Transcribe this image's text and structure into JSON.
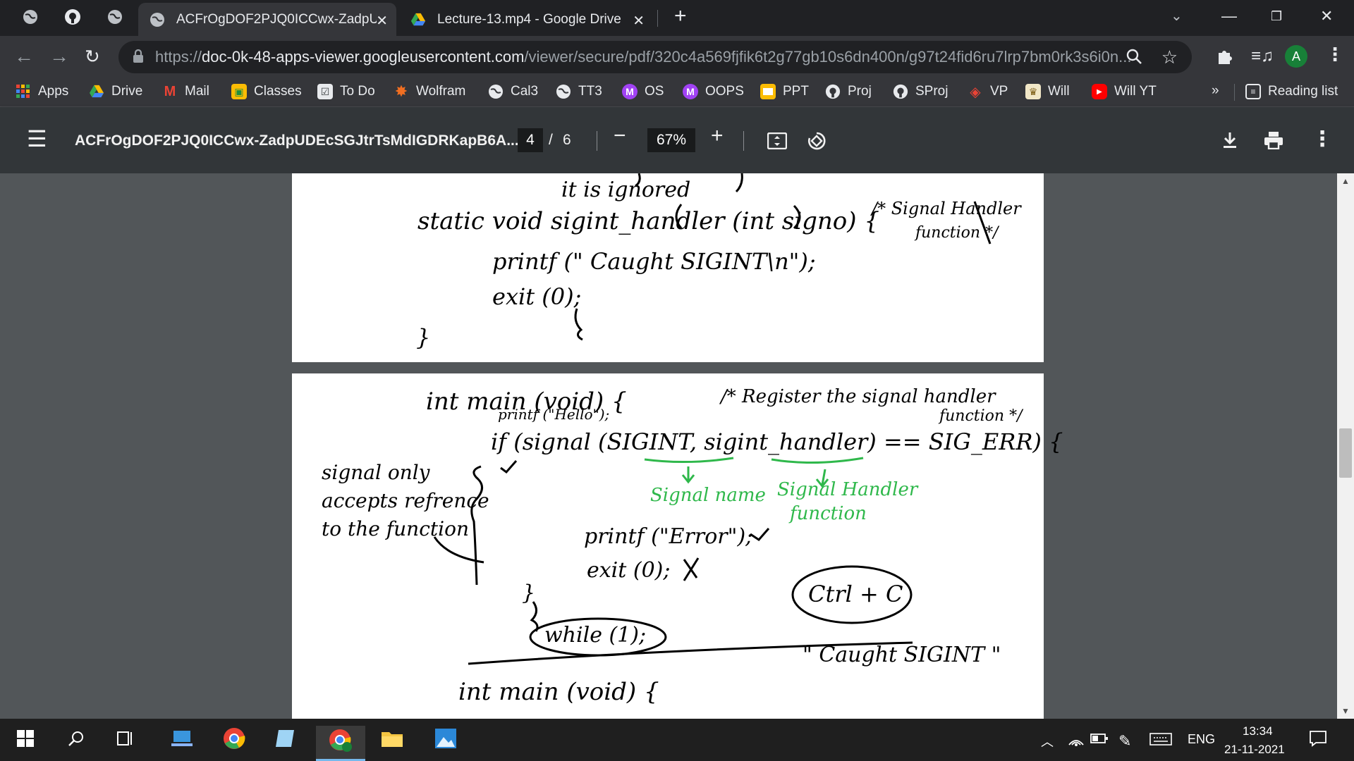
{
  "tabs": [
    {
      "title": "ACFrOgDOF2PJQ0ICCwx-ZadpUD",
      "icon": "globe-icon",
      "active": true
    },
    {
      "title": "Lecture-13.mp4 - Google Drive",
      "icon": "google-drive-icon",
      "active": false
    }
  ],
  "address_bar": {
    "scheme": "https://",
    "host": "doc-0k-48-apps-viewer.googleusercontent.com",
    "path": "/viewer/secure/pdf/320c4a569fjfik6t2g77gb10s6dn400n/g97t24fid6ru7lrp7bm0rk3s6i0n..."
  },
  "profile_initial": "A",
  "bookmarks": [
    {
      "label": "Apps",
      "icon": "apps-grid-icon"
    },
    {
      "label": "Drive",
      "icon": "google-drive-icon"
    },
    {
      "label": "Mail",
      "icon": "gmail-icon"
    },
    {
      "label": "Classes",
      "icon": "classroom-icon"
    },
    {
      "label": "To Do",
      "icon": "todo-icon"
    },
    {
      "label": "Wolfram",
      "icon": "wolfram-icon"
    },
    {
      "label": "Cal3",
      "icon": "globe-icon"
    },
    {
      "label": "TT3",
      "icon": "globe-icon"
    },
    {
      "label": "OS",
      "icon": "m-badge-icon"
    },
    {
      "label": "OOPS",
      "icon": "m-badge-icon"
    },
    {
      "label": "PPT",
      "icon": "slides-icon"
    },
    {
      "label": "Proj",
      "icon": "github-icon"
    },
    {
      "label": "SProj",
      "icon": "github-icon"
    },
    {
      "label": "VP",
      "icon": "vp-icon"
    },
    {
      "label": "Will",
      "icon": "crest-icon"
    },
    {
      "label": "Will YT",
      "icon": "youtube-icon"
    }
  ],
  "bookmarks_overflow": "»",
  "reading_list": "Reading list",
  "pdf": {
    "title": "ACFrOgDOF2PJQ0ICCwx-ZadpUDEcSGJtrTsMdIGDRKapB6A...",
    "current_page": "4",
    "page_separator": "/",
    "total_pages": "6",
    "zoom": "67%"
  },
  "notes": {
    "page1": {
      "line0": "it is ignored",
      "line1": "static void sigint_handler (int signo) {",
      "comment1": "/* Signal Handler",
      "comment2": "function */",
      "line2": "printf (\" Caught SIGINT\\n\");",
      "line3": "exit (0);",
      "line4": "}"
    },
    "page2": {
      "main": "int main (void) {",
      "printf_hello": "printf (\"Hello\");",
      "register1": "/* Register the signal handler",
      "register2": "function */",
      "if_line": "if (signal (SIGINT, sigint_handler) == SIG_ERR) {",
      "side1": "signal only",
      "side2": "accepts refrence",
      "side3": "to the function",
      "label_signal": "Signal name",
      "label_handler1": "Signal Handler",
      "label_handler2": "function",
      "printf_error": "printf (\"Error\");",
      "exit": "exit (0);",
      "close": "}",
      "ctrl": "Ctrl + C",
      "while": "while (1);",
      "caught": "\" Caught SIGINT \"",
      "main2": "int main (void) {"
    }
  },
  "taskbar": {
    "language": "ENG",
    "time": "13:34",
    "date": "21-11-2021"
  }
}
